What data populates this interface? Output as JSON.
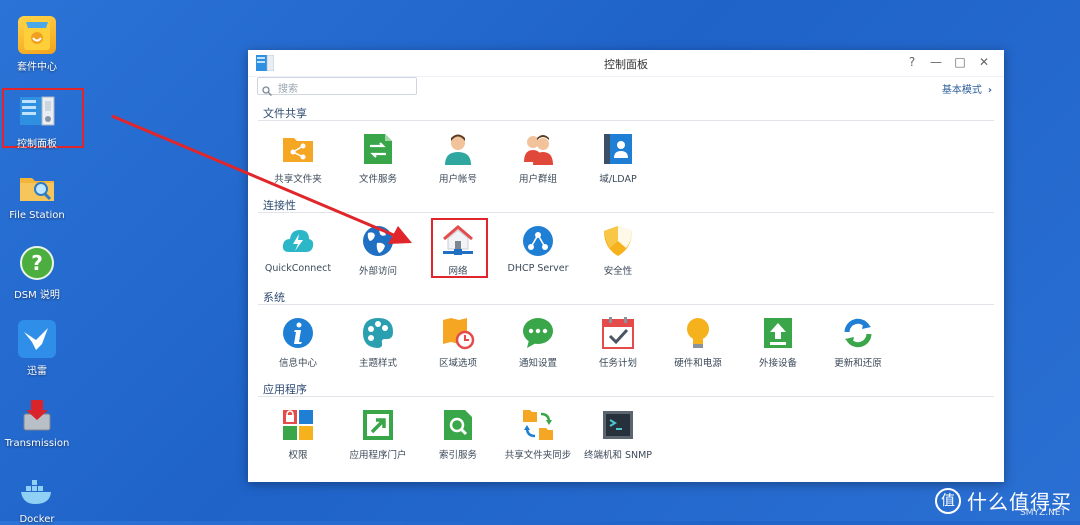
{
  "desktop": {
    "icons": [
      {
        "label": "套件中心"
      },
      {
        "label": "控制面板"
      },
      {
        "label": "File Station"
      },
      {
        "label": "DSM 说明"
      },
      {
        "label": "迅雷"
      },
      {
        "label": "Transmission"
      },
      {
        "label": "Docker"
      }
    ]
  },
  "window": {
    "title": "控制面板",
    "buttons": {
      "help": "?",
      "minimize": "—",
      "maximize": "□",
      "close": "✕"
    },
    "search_placeholder": "搜索",
    "mode_label": "基本模式",
    "sections": [
      {
        "title": "文件共享",
        "items": [
          "共享文件夹",
          "文件服务",
          "用户帐号",
          "用户群组",
          "域/LDAP"
        ]
      },
      {
        "title": "连接性",
        "items": [
          "QuickConnect",
          "外部访问",
          "网络",
          "DHCP Server",
          "安全性"
        ]
      },
      {
        "title": "系统",
        "items": [
          "信息中心",
          "主题样式",
          "区域选项",
          "通知设置",
          "任务计划",
          "硬件和电源",
          "外接设备",
          "更新和还原"
        ]
      },
      {
        "title": "应用程序",
        "items": [
          "权限",
          "应用程序门户",
          "索引服务",
          "共享文件夹同步",
          "终端机和 SNMP"
        ]
      }
    ]
  },
  "watermark": {
    "badge": "值",
    "text": "什么值得买",
    "sub": "SMYZ.NET"
  }
}
